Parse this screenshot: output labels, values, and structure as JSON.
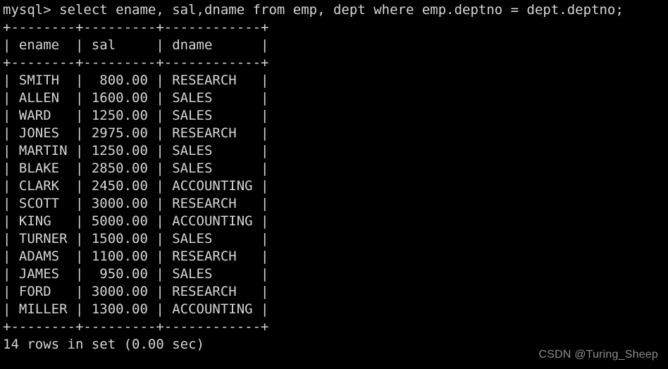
{
  "terminal": {
    "prompt": "mysql>",
    "query": "select ename, sal,dname from emp, dept where emp.deptno = dept.deptno;",
    "prompt_line": "mysql> select ename, sal,dname from emp, dept where emp.deptno = dept.deptno;",
    "separator": "+--------+---------+------------+",
    "header_line": "| ename  | sal     | dname      |",
    "footer": "14 rows in set (0.00 sec)",
    "row_count": 14,
    "elapsed": "0.00 sec",
    "watermark": "CSDN @Turing_Sheep",
    "colors": {
      "background": "#000000",
      "foreground": "#d6d6d6",
      "watermark": "#8d8d8d"
    },
    "columns": [
      {
        "name": "ename",
        "width": 8,
        "align": "left"
      },
      {
        "name": "sal",
        "width": 9,
        "align": "right"
      },
      {
        "name": "dname",
        "width": 12,
        "align": "left"
      }
    ],
    "rows": [
      {
        "ename": "SMITH",
        "sal": "800.00",
        "dname": "RESEARCH",
        "line": "| SMITH  |  800.00 | RESEARCH   |"
      },
      {
        "ename": "ALLEN",
        "sal": "1600.00",
        "dname": "SALES",
        "line": "| ALLEN  | 1600.00 | SALES      |"
      },
      {
        "ename": "WARD",
        "sal": "1250.00",
        "dname": "SALES",
        "line": "| WARD   | 1250.00 | SALES      |"
      },
      {
        "ename": "JONES",
        "sal": "2975.00",
        "dname": "RESEARCH",
        "line": "| JONES  | 2975.00 | RESEARCH   |"
      },
      {
        "ename": "MARTIN",
        "sal": "1250.00",
        "dname": "SALES",
        "line": "| MARTIN | 1250.00 | SALES      |"
      },
      {
        "ename": "BLAKE",
        "sal": "2850.00",
        "dname": "SALES",
        "line": "| BLAKE  | 2850.00 | SALES      |"
      },
      {
        "ename": "CLARK",
        "sal": "2450.00",
        "dname": "ACCOUNTING",
        "line": "| CLARK  | 2450.00 | ACCOUNTING |"
      },
      {
        "ename": "SCOTT",
        "sal": "3000.00",
        "dname": "RESEARCH",
        "line": "| SCOTT  | 3000.00 | RESEARCH   |"
      },
      {
        "ename": "KING",
        "sal": "5000.00",
        "dname": "ACCOUNTING",
        "line": "| KING   | 5000.00 | ACCOUNTING |"
      },
      {
        "ename": "TURNER",
        "sal": "1500.00",
        "dname": "SALES",
        "line": "| TURNER | 1500.00 | SALES      |"
      },
      {
        "ename": "ADAMS",
        "sal": "1100.00",
        "dname": "RESEARCH",
        "line": "| ADAMS  | 1100.00 | RESEARCH   |"
      },
      {
        "ename": "JAMES",
        "sal": "950.00",
        "dname": "SALES",
        "line": "| JAMES  |  950.00 | SALES      |"
      },
      {
        "ename": "FORD",
        "sal": "3000.00",
        "dname": "RESEARCH",
        "line": "| FORD   | 3000.00 | RESEARCH   |"
      },
      {
        "ename": "MILLER",
        "sal": "1300.00",
        "dname": "ACCOUNTING",
        "line": "| MILLER | 1300.00 | ACCOUNTING |"
      }
    ]
  }
}
